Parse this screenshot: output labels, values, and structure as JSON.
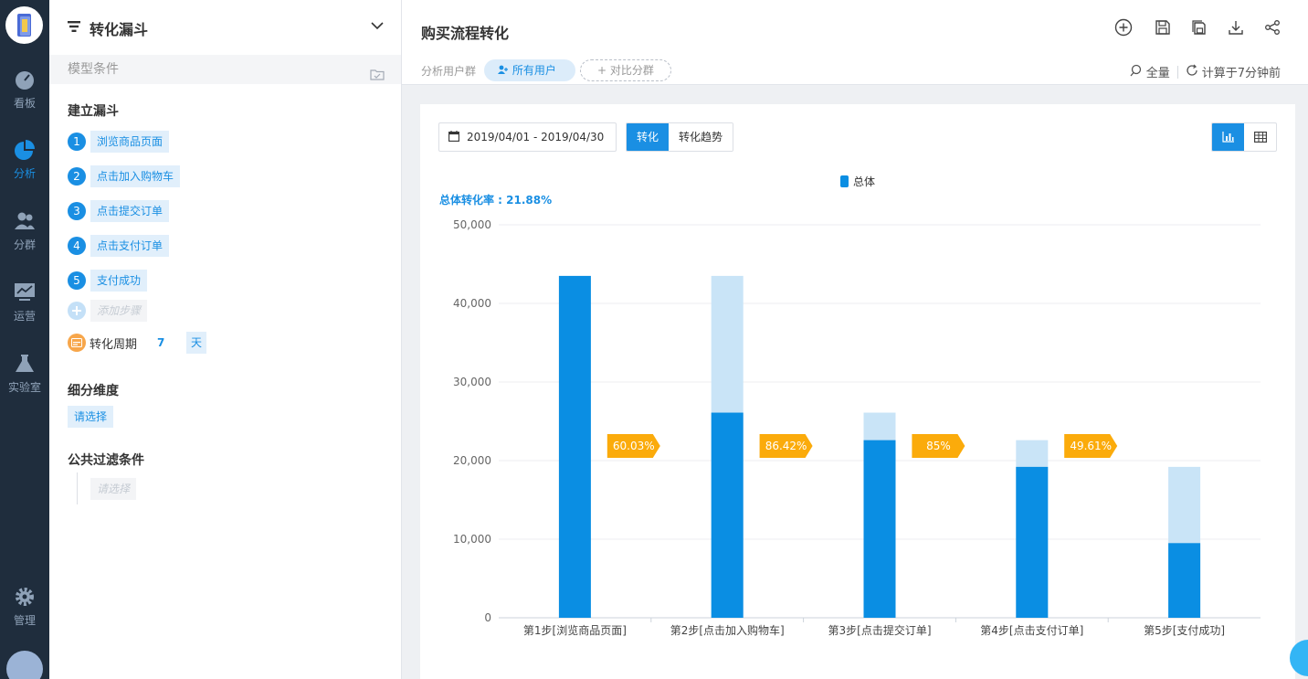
{
  "nav": {
    "items": [
      {
        "label": "看板",
        "icon": "dashboard-icon"
      },
      {
        "label": "分析",
        "icon": "pie-chart-icon",
        "active": true
      },
      {
        "label": "分群",
        "icon": "users-icon"
      },
      {
        "label": "运营",
        "icon": "monitor-icon"
      },
      {
        "label": "实验室",
        "icon": "flask-icon"
      },
      {
        "label": "管理",
        "icon": "gear-icon"
      }
    ]
  },
  "panel": {
    "title": "转化漏斗",
    "model_conditions": "模型条件",
    "build_funnel": "建立漏斗",
    "steps": [
      {
        "num": "1",
        "label": "浏览商品页面"
      },
      {
        "num": "2",
        "label": "点击加入购物车"
      },
      {
        "num": "3",
        "label": "点击提交订单"
      },
      {
        "num": "4",
        "label": "点击支付订单"
      },
      {
        "num": "5",
        "label": "支付成功"
      }
    ],
    "add_step_placeholder": "添加步骤",
    "period_label": "转化周期",
    "period_value": "7",
    "period_unit": "天",
    "dimension_title": "细分维度",
    "dimension_select": "请选择",
    "filter_title": "公共过滤条件",
    "filter_select": "请选择"
  },
  "header": {
    "title": "购买流程转化",
    "group_label": "分析用户群",
    "group_value": "所有用户",
    "compare_label": "对比分群",
    "sample": "全量",
    "computed": "计算于7分钟前"
  },
  "controls": {
    "date_range": "2019/04/01 - 2019/04/30",
    "tab_conversion": "转化",
    "tab_trend": "转化趋势"
  },
  "chart_data": {
    "type": "bar",
    "legend": "总体",
    "overall_label": "总体转化率 : 21.88%",
    "categories": [
      "第1步[浏览商品页面]",
      "第2步[点击加入购物车]",
      "第3步[点击提交订单]",
      "第4步[点击支付订单]",
      "第5步[支付成功]"
    ],
    "values": [
      43500,
      26100,
      22600,
      19200,
      9500
    ],
    "conversion_rates": [
      "60.03%",
      "86.42%",
      "85%",
      "49.61%"
    ],
    "yticks": [
      "0",
      "10,000",
      "20,000",
      "30,000",
      "40,000",
      "50,000"
    ],
    "ylim": [
      0,
      50000
    ],
    "colors": {
      "bar": "#0a8ee3",
      "previous": "#c9e4f7",
      "rate": "#fbab0b"
    }
  }
}
